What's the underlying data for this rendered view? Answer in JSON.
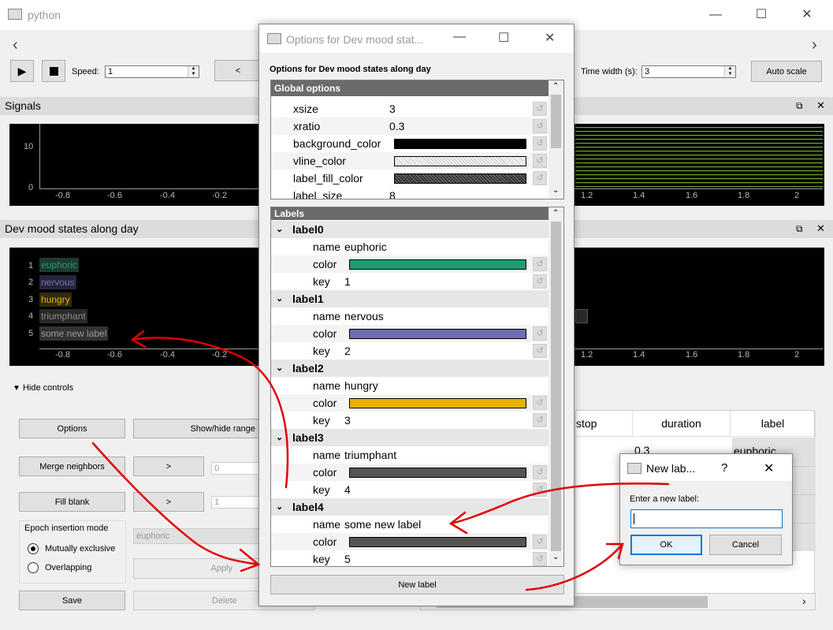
{
  "main": {
    "title": "python",
    "nav_left": "‹",
    "nav_right": "›",
    "speed_label": "Speed:",
    "speed_value": "1",
    "back_label": "<",
    "time_width_label": "Time width (s):",
    "time_width_value": "3",
    "auto_scale_label": "Auto scale"
  },
  "signals": {
    "title": "Signals",
    "y_ticks": [
      "10",
      "0"
    ],
    "x_ticks_left": [
      "-0.8",
      "-0.6",
      "-0.4",
      "-0.2"
    ],
    "x_ticks_right": [
      "1.2",
      "1.4",
      "1.6",
      "1.8",
      "2"
    ]
  },
  "epochs": {
    "title": "Dev mood states along day",
    "labels": [
      {
        "num": "1",
        "name": "euphoric",
        "color": "#2a9a72"
      },
      {
        "num": "2",
        "name": "nervous",
        "color": "#6f6fb8"
      },
      {
        "num": "3",
        "name": "hungry",
        "color": "#eab300"
      },
      {
        "num": "4",
        "name": "triumphant",
        "color": "#7a7a7a"
      },
      {
        "num": "5",
        "name": "some new label",
        "color": "#8c8c8c"
      }
    ],
    "x_ticks_left": [
      "-0.8",
      "-0.6",
      "-0.4",
      "-0.2"
    ],
    "x_ticks_right": [
      "1.2",
      "1.4",
      "1.6",
      "1.8",
      "2"
    ]
  },
  "controls": {
    "hide_label": "Hide controls",
    "options": "Options",
    "show_hide_range": "Show/hide range",
    "merge": "Merge neighbors",
    "merge_arrow": ">",
    "merge_value": "0",
    "fill_blank": "Fill blank",
    "fill_arrow": ">",
    "fill_value": "1",
    "insertion_mode_title": "Epoch insertion mode",
    "mutually_exclusive": "Mutually exclusive",
    "overlapping": "Overlapping",
    "combo_value": "euphoric",
    "apply": "Apply",
    "save": "Save",
    "delete": "Delete"
  },
  "table": {
    "headers": [
      "stop",
      "duration",
      "label"
    ],
    "row1_duration": "0.3",
    "row1_label": "euphoric"
  },
  "options_dialog": {
    "title": "Options for Dev mood stat...",
    "heading": "Options for Dev mood states along day",
    "global_header": "Global options",
    "global": [
      {
        "name": "xsize",
        "value": "3"
      },
      {
        "name": "xratio",
        "value": "0.3"
      },
      {
        "name": "background_color",
        "value": ""
      },
      {
        "name": "vline_color",
        "value": ""
      },
      {
        "name": "label_fill_color",
        "value": ""
      },
      {
        "name": "label_size",
        "value": "8"
      }
    ],
    "labels_header": "Labels",
    "labels": [
      {
        "id": "label0",
        "name": "euphoric",
        "color": "#1f9a73",
        "key": "1"
      },
      {
        "id": "label1",
        "name": "nervous",
        "color": "#6e6eb4",
        "key": "2"
      },
      {
        "id": "label2",
        "name": "hungry",
        "color": "#e9b000",
        "key": "3"
      },
      {
        "id": "label3",
        "name": "triumphant",
        "color": "#555555",
        "key": "4"
      },
      {
        "id": "label4",
        "name": "some new label",
        "color": "#555555",
        "key": "5"
      }
    ],
    "name_word": "name",
    "color_word": "color",
    "key_word": "key",
    "new_label_button": "New label"
  },
  "new_label_dialog": {
    "title": "New lab...",
    "help": "?",
    "prompt": "Enter a new label:",
    "value": "",
    "ok": "OK",
    "cancel": "Cancel"
  },
  "colors": {
    "annotation_arrow": "#e00000",
    "accent": "#0078d7"
  }
}
